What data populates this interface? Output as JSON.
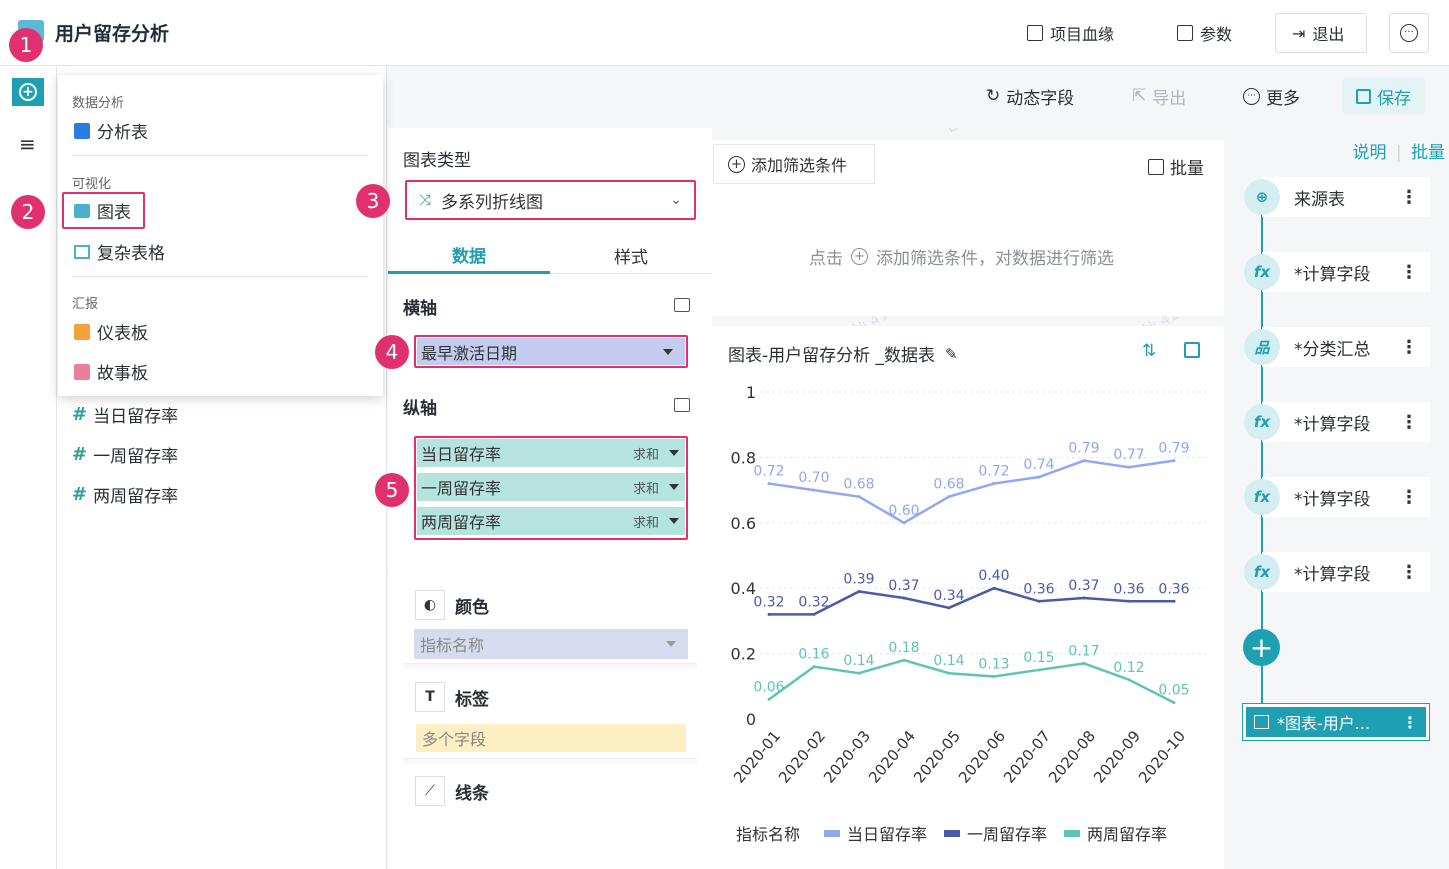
{
  "header": {
    "title": "用户留存分析",
    "lineage": "项目血缘",
    "params": "参数",
    "exit": "退出"
  },
  "toolbar": {
    "dynamic_field": "动态字段",
    "export": "导出",
    "more": "更多",
    "save": "保存"
  },
  "menu": {
    "cat_analysis": "数据分析",
    "analysis_table": "分析表",
    "cat_visual": "可视化",
    "chart": "图表",
    "complex_table": "复杂表格",
    "cat_report": "汇报",
    "dashboard": "仪表板",
    "storyboard": "故事板"
  },
  "fields": [
    "当日留存率",
    "一周留存率",
    "两周留存率"
  ],
  "config": {
    "chart_type_label": "图表类型",
    "chart_type_value": "多系列折线图",
    "tab_data": "数据",
    "tab_style": "样式",
    "x_axis_label": "横轴",
    "x_field": "最早激活日期",
    "y_axis_label": "纵轴",
    "y_fields": [
      {
        "name": "当日留存率",
        "agg": "求和"
      },
      {
        "name": "一周留存率",
        "agg": "求和"
      },
      {
        "name": "两周留存率",
        "agg": "求和"
      }
    ],
    "color_label": "颜色",
    "color_field": "指标名称",
    "tag_label": "标签",
    "tag_field": "多个字段",
    "line_label": "线条"
  },
  "filter": {
    "add_btn": "添加筛选条件",
    "batch": "批量",
    "hint_prefix": "点击",
    "hint_suffix": "添加筛选条件，对数据进行筛选"
  },
  "chart_title": "图表-用户留存分析 _数据表",
  "chart_data": {
    "type": "line",
    "categories": [
      "2020-01",
      "2020-02",
      "2020-03",
      "2020-04",
      "2020-05",
      "2020-06",
      "2020-07",
      "2020-08",
      "2020-09",
      "2020-10"
    ],
    "series": [
      {
        "name": "当日留存率",
        "color": "#8fa8f0",
        "values": [
          0.72,
          0.7,
          0.68,
          0.6,
          0.68,
          0.72,
          0.74,
          0.79,
          0.77,
          0.79
        ]
      },
      {
        "name": "一周留存率",
        "color": "#4a5aa8",
        "values": [
          0.32,
          0.32,
          0.39,
          0.37,
          0.34,
          0.4,
          0.36,
          0.37,
          0.36,
          0.36
        ]
      },
      {
        "name": "两周留存率",
        "color": "#5ec4b6",
        "values": [
          0.06,
          0.16,
          0.14,
          0.18,
          0.14,
          0.13,
          0.15,
          0.17,
          0.12,
          0.05
        ]
      }
    ],
    "yticks": [
      "0",
      "0.2",
      "0.4",
      "0.6",
      "0.8",
      "1"
    ],
    "ylim": [
      0,
      1
    ],
    "legend_title": "指标名称",
    "legend_position": "bottom"
  },
  "right": {
    "explain": "说明",
    "batch": "批量",
    "steps": [
      "来源表",
      "*计算字段",
      "*分类汇总",
      "*计算字段",
      "*计算字段",
      "*计算字段"
    ],
    "final": "*图表-用户..."
  },
  "annotations": [
    "1",
    "2",
    "3",
    "4",
    "5"
  ],
  "colors": {
    "accent": "#1e9fb2",
    "highlight": "#e0316e"
  }
}
